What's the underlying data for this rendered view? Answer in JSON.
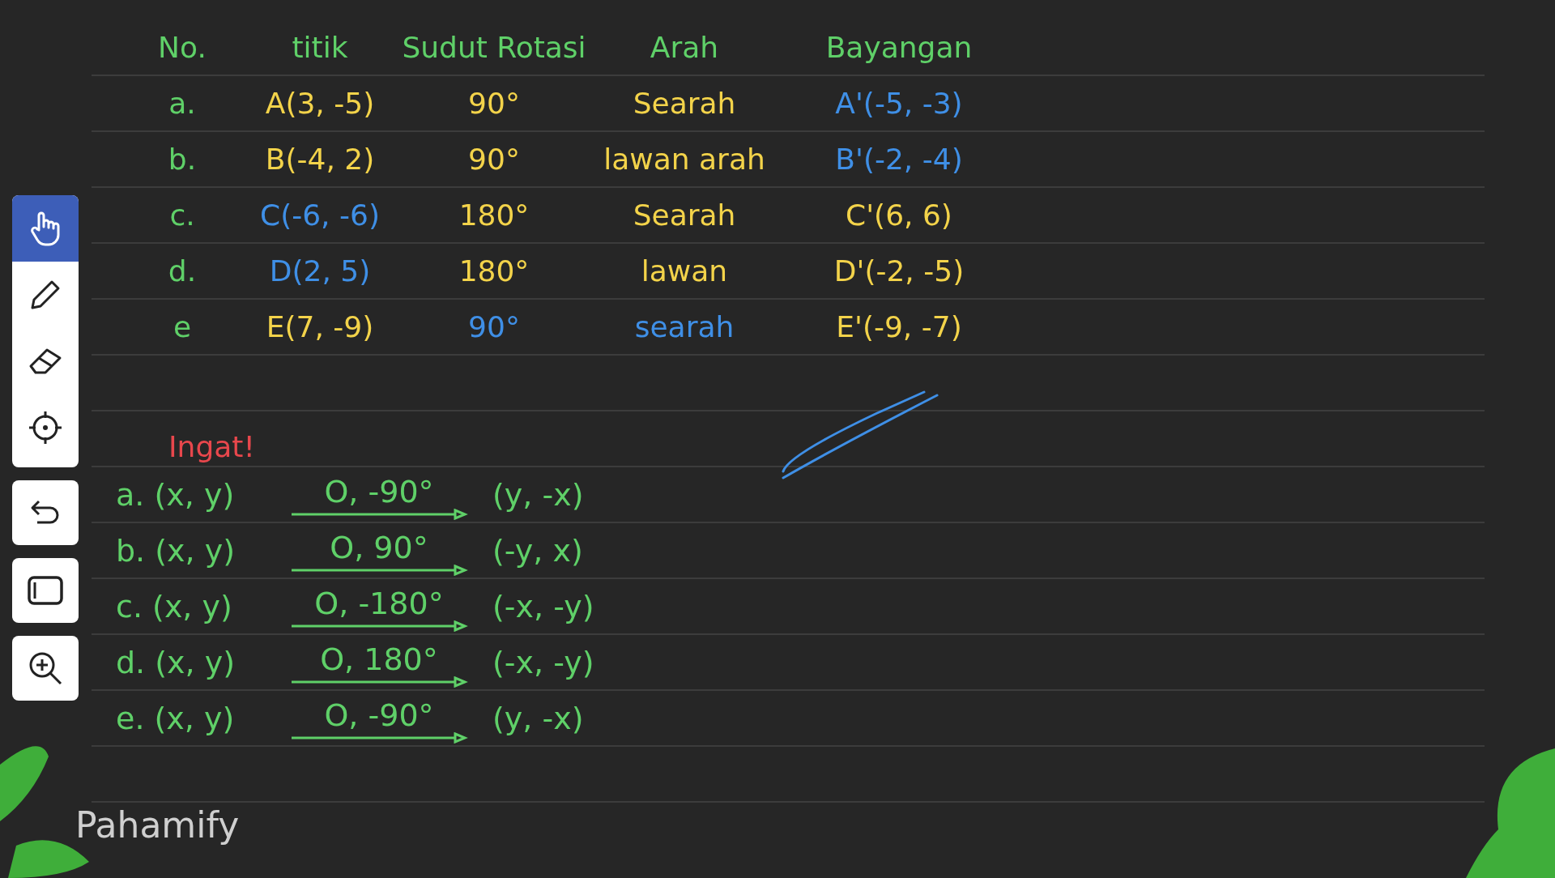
{
  "toolbar": {
    "tools": [
      {
        "kind": "hand",
        "selected": true
      },
      {
        "kind": "pen",
        "selected": false
      },
      {
        "kind": "eraser",
        "selected": false
      },
      {
        "kind": "laser",
        "selected": false
      }
    ],
    "actions": [
      {
        "kind": "undo"
      },
      {
        "kind": "shape"
      },
      {
        "kind": "zoom"
      }
    ]
  },
  "table": {
    "columns": [
      "No.",
      "titik",
      "Sudut Rotasi",
      "Arah",
      "Bayangan"
    ],
    "rows": [
      {
        "cells": [
          {
            "text": "a.",
            "color": "#5fd068"
          },
          {
            "text": "A(3, -5)",
            "color": "#f3d34a"
          },
          {
            "text": "90°",
            "color": "#f3d34a"
          },
          {
            "text": "Searah",
            "color": "#f3d34a"
          },
          {
            "text": "A'(-5, -3)",
            "color": "#3f8fe6"
          }
        ]
      },
      {
        "cells": [
          {
            "text": "b.",
            "color": "#5fd068"
          },
          {
            "text": "B(-4, 2)",
            "color": "#f3d34a"
          },
          {
            "text": "90°",
            "color": "#f3d34a"
          },
          {
            "text": "lawan arah",
            "color": "#f3d34a"
          },
          {
            "text": "B'(-2, -4)",
            "color": "#3f8fe6"
          }
        ]
      },
      {
        "cells": [
          {
            "text": "c.",
            "color": "#5fd068"
          },
          {
            "text": "C(-6, -6)",
            "color": "#3f8fe6"
          },
          {
            "text": "180°",
            "color": "#f3d34a"
          },
          {
            "text": "Searah",
            "color": "#f3d34a"
          },
          {
            "text": "C'(6, 6)",
            "color": "#f3d34a"
          }
        ]
      },
      {
        "cells": [
          {
            "text": "d.",
            "color": "#5fd068"
          },
          {
            "text": "D(2, 5)",
            "color": "#3f8fe6"
          },
          {
            "text": "180°",
            "color": "#f3d34a"
          },
          {
            "text": "lawan",
            "color": "#f3d34a"
          },
          {
            "text": "D'(-2, -5)",
            "color": "#f3d34a"
          }
        ]
      },
      {
        "cells": [
          {
            "text": "e",
            "color": "#5fd068"
          },
          {
            "text": "E(7, -9)",
            "color": "#f3d34a"
          },
          {
            "text": "90°",
            "color": "#3f8fe6"
          },
          {
            "text": "searah",
            "color": "#3f8fe6"
          },
          {
            "text": "E'(-9, -7)",
            "color": "#f3d34a"
          }
        ]
      }
    ]
  },
  "note": {
    "title": "Ingat!",
    "rules": [
      {
        "label": "a. (x, y)",
        "rotation": "O, -90°",
        "result": "(y, -x)"
      },
      {
        "label": "b. (x, y)",
        "rotation": "O, 90°",
        "result": "(-y, x)"
      },
      {
        "label": "c. (x, y)",
        "rotation": "O, -180°",
        "result": "(-x, -y)"
      },
      {
        "label": "d. (x, y)",
        "rotation": "O, 180°",
        "result": "(-x, -y)"
      },
      {
        "label": "e. (x, y)",
        "rotation": "O, -90°",
        "result": "(y, -x)"
      }
    ]
  },
  "logo": "Pahamify"
}
